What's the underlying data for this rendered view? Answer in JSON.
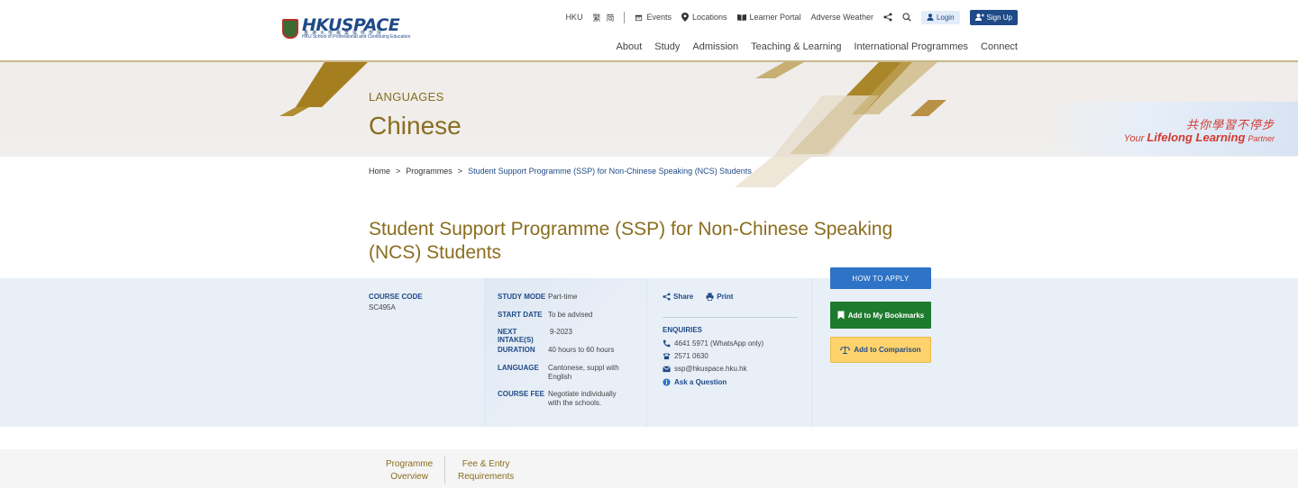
{
  "header": {
    "logo_text": "HKUSPACE",
    "logo_chinese": "香港大學專業進修學院",
    "logo_sub": "HKU School of Professional and Continuing Education",
    "utility": [
      {
        "label": "HKU",
        "icon": ""
      },
      {
        "label": "繁",
        "icon": ""
      },
      {
        "label": "简",
        "icon": ""
      },
      {
        "label": "Events",
        "icon": "calendar-icon"
      },
      {
        "label": "Locations",
        "icon": "location-pin-icon"
      },
      {
        "label": "Learner Portal",
        "icon": "book-icon"
      },
      {
        "label": "Adverse Weather",
        "icon": ""
      }
    ],
    "login_label": "Login",
    "signup_label": "Sign Up",
    "nav": [
      "About",
      "Study",
      "Admission",
      "Teaching & Learning",
      "International Programmes",
      "Connect"
    ]
  },
  "banner": {
    "category": "LANGUAGES",
    "title": "Chinese",
    "slogan_cn": "共你學習不停步",
    "slogan_en_prefix": "Your",
    "slogan_en_bold": "Lifelong Learning",
    "slogan_en_suffix": "Partner"
  },
  "breadcrumb": {
    "home": "Home",
    "sep": ">",
    "programmes": "Programmes",
    "current": "Student Support Programme (SSP) for Non-Chinese Speaking (NCS) Students"
  },
  "programme": {
    "title": "Student Support Programme (SSP) for Non-Chinese Speaking (NCS) Students",
    "course_code_label": "COURSE CODE",
    "course_code": "SC495A",
    "details": [
      {
        "label": "STUDY MODE",
        "value": "Part-time"
      },
      {
        "label": "START DATE",
        "value": "To be advised"
      },
      {
        "label": "NEXT INTAKE(S)",
        "value": "9-2023"
      },
      {
        "label": "DURATION",
        "value": "40 hours to 60 hours"
      },
      {
        "label": "LANGUAGE",
        "value": "Cantonese, suppl with English"
      },
      {
        "label": "COURSE FEE",
        "value": "Negotiate individually with the schools."
      }
    ]
  },
  "actions": {
    "share": "Share",
    "print": "Print"
  },
  "enquiries": {
    "title": "ENQUIRIES",
    "whatsapp": "4641 5971 (WhatsApp only)",
    "phone": "2571 0630",
    "email": "ssp@hkuspace.hku.hk",
    "ask": "Ask a Question"
  },
  "buttons": {
    "apply": "HOW TO APPLY",
    "bookmark": "Add to My Bookmarks",
    "compare": "Add to Comparison"
  },
  "tabs": {
    "overview_1": "Programme",
    "overview_2": "Overview",
    "fee_1": "Fee & Entry",
    "fee_2": "Requirements"
  },
  "colors": {
    "gold": "#8a6d1f",
    "navy": "#1f4a87",
    "green": "#1e7a2e",
    "yellow": "#ffd36b",
    "blue": "#2e73c6"
  }
}
